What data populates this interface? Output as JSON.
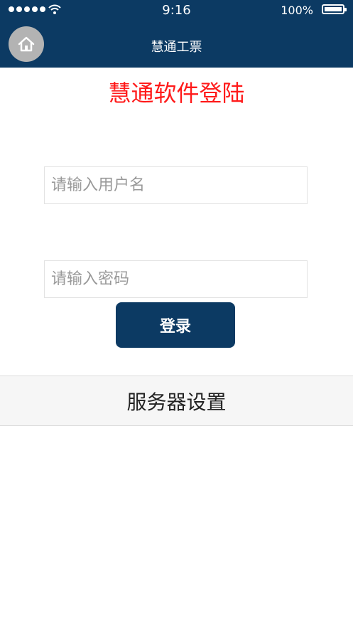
{
  "status_bar": {
    "time": "9:16",
    "battery": "100%",
    "signal_icon": "signal-dots-icon",
    "wifi_icon": "wifi-icon",
    "battery_icon": "battery-icon"
  },
  "navbar": {
    "title": "慧通工票",
    "home_icon": "home-icon",
    "background": "#0c3a63"
  },
  "login": {
    "heading": "慧通软件登陆",
    "heading_color": "#ff1a1a",
    "username_placeholder": "请输入用户名",
    "password_placeholder": "请输入密码",
    "submit_label": "登录"
  },
  "server_settings": {
    "label": "服务器设置"
  }
}
